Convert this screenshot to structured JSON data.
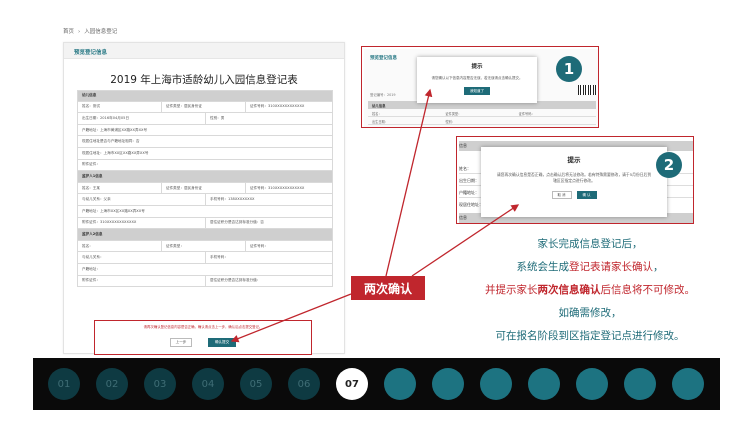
{
  "breadcrumb": {
    "home": "首页",
    "separator": "›",
    "current": "入园信息登记"
  },
  "form": {
    "tab": "预览登记信息",
    "title": "2019 年上海市适龄幼儿入园信息登记表",
    "rows": [
      {
        "type": "section",
        "cells": [
          "幼儿信息"
        ]
      },
      {
        "type": "r3",
        "cells": [
          "姓名：测试",
          "证件类型：居民身份证",
          "证件号码：310XXXXXXXXXXXX"
        ]
      },
      {
        "type": "r2",
        "cells": [
          "出生日期：2016年04月05日",
          "性别：男"
        ]
      },
      {
        "type": "r1",
        "cells": [
          "户籍地址：上海市黄浦区XX路XX弄XX号"
        ]
      },
      {
        "type": "r1",
        "cells": [
          "现居住地址是否与户籍地址相同：否"
        ]
      },
      {
        "type": "r1",
        "cells": [
          "现居住地址：上海市XX区XX路XX弄XX号"
        ]
      },
      {
        "type": "r1",
        "cells": [
          "附件证件："
        ]
      },
      {
        "type": "section",
        "cells": [
          "监护人1信息"
        ]
      },
      {
        "type": "r3",
        "cells": [
          "姓名：王某",
          "证件类型：居民身份证",
          "证件号码：310XXXXXXXXXXXX"
        ]
      },
      {
        "type": "r2",
        "cells": [
          "与幼儿关系：父亲",
          "手机号码：138XXXXXXXX"
        ]
      },
      {
        "type": "r1",
        "cells": [
          "户籍地址：上海市XX区XX路XX弄XX号"
        ]
      },
      {
        "type": "r2",
        "cells": [
          "附件证件：310XXXXXXXXXXXX",
          "居住证积分是否达到标准分值：否"
        ]
      },
      {
        "type": "section",
        "cells": [
          "监护人2信息"
        ]
      },
      {
        "type": "r3",
        "cells": [
          "姓名：",
          "证件类型：",
          "证件号码："
        ]
      },
      {
        "type": "r2",
        "cells": [
          "与幼儿关系：",
          "手机号码："
        ]
      },
      {
        "type": "r1",
        "cells": [
          "户籍地址："
        ]
      },
      {
        "type": "r2",
        "cells": [
          "附件证件：",
          "居住证积分是否达到标准分值："
        ]
      }
    ],
    "confirm_note": "请再次确认登记信息内容是否正确，确认请点击上一步，确认后点击提交登记。",
    "prev_button": "上一步",
    "confirm_button": "确认提交"
  },
  "shot1": {
    "tab": "预览登记信息",
    "sub_label": "登记编号：2019",
    "section": "幼儿信息",
    "row1": [
      "姓名：",
      "证件类型：",
      "证件号码："
    ],
    "row2": [
      "出生日期：",
      "性别：",
      ""
    ],
    "dialog_title": "提示",
    "dialog_message": "请您确认以下信息内容是否无误，若无误请点击确认提交。",
    "dialog_button": "我知道了",
    "badge": "1"
  },
  "shot2": {
    "labels": [
      "信息",
      "姓名：",
      "出生日期：",
      "户籍地址：",
      "现居住地址：",
      "信息"
    ],
    "dialog_title": "提示",
    "dialog_message": "请您再次确认信息是否正确，点击确认后将无法修改。若有特殊需要修改，请于5月份日后到辖区区指定点进行修改。",
    "cancel_button": "取 消",
    "confirm_button": "确 认",
    "badge": "2"
  },
  "twice_label": "两次确认",
  "description": {
    "line1": "家长完成信息登记后，",
    "line2_a": "系统会生成",
    "line2_b": "登记表请家长确认",
    "line2_c": "，",
    "line3_a": "并提示家长",
    "line3_b": "两次信息确认",
    "line3_c": "后信息将不可修改。",
    "line4": "如确需修改，",
    "line5": "可在报名阶段到区指定登记点进行修改。"
  },
  "steps": {
    "labels": [
      "01",
      "02",
      "03",
      "04",
      "05",
      "06",
      "07"
    ],
    "active": "07",
    "future_count": 7
  },
  "colors": {
    "accent": "#1e6b78",
    "warning": "#c0262d",
    "bar": "#0a0a0a"
  }
}
